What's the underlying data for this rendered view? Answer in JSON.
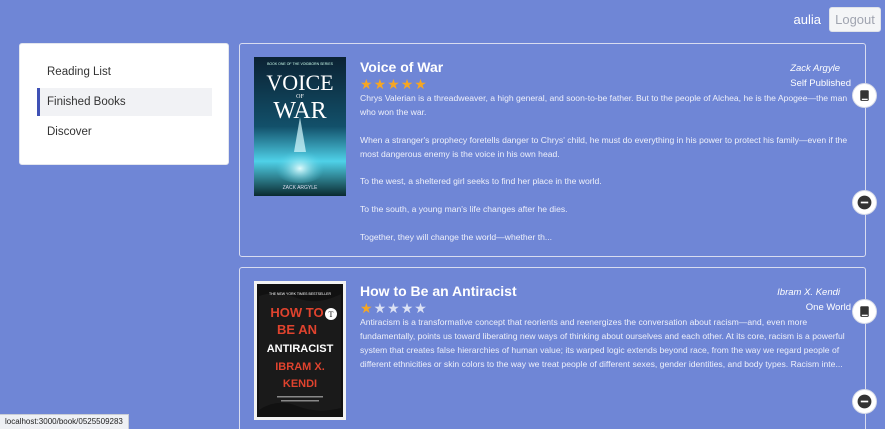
{
  "header": {
    "username": "aulia",
    "logout_label": "Logout"
  },
  "sidebar": {
    "items": [
      {
        "label": "Reading List"
      },
      {
        "label": "Finished Books"
      },
      {
        "label": "Discover"
      }
    ]
  },
  "books": [
    {
      "title": "Voice of War",
      "author": "Zack Argyle",
      "publisher": "Self Published",
      "rating": 5,
      "cover": {
        "small": "BOOK ONE OF THE VOIDBORN SERIES",
        "line1": "VOICE",
        "line2": "OF",
        "line3": "WAR",
        "author": "ZACK ARGYLE"
      },
      "description": [
        "Chrys Valerian is a threadweaver, a high general, and soon-to-be father. But to the people of Alchea, he is the Apogee—the man who won the war.",
        "When a stranger's prophecy foretells danger to Chrys' child, he must do everything in his power to protect his family—even if the most dangerous enemy is the voice in his own head.",
        "To the west, a sheltered girl seeks to find her place in the world.",
        "To the south, a young man's life changes after he dies.",
        "Together, they will change the world—whether th..."
      ]
    },
    {
      "title": "How to Be an Antiracist",
      "author": "Ibram X. Kendi",
      "publisher": "One World",
      "rating": 1,
      "cover": {
        "small": "THE NEW YORK TIMES BESTSELLER",
        "line1": "HOW TO",
        "line2": "BE AN",
        "line3": "ANTIRACIST",
        "line4": "IBRAM X.",
        "line5": "KENDI"
      },
      "description": [
        "Antiracism is a transformative concept that reorients and reenergizes the conversation about racism—and, even more fundamentally, points us toward liberating new ways of thinking about ourselves and each other. At its core, racism is a powerful system that creates false hierarchies of human value; its warped logic extends beyond race, from the way we regard people of different ethnicities or skin colors to the way we treat people of different sexes, gender identities, and body types. Racism inte..."
      ]
    }
  ],
  "status_bar": {
    "url": "localhost:3000/book/0525509283"
  },
  "icons": {
    "book": "book-icon",
    "remove": "minus-circle-icon"
  },
  "colors": {
    "background": "#6f86d6",
    "star": "#f5a623",
    "accent": "#3f51b5"
  }
}
